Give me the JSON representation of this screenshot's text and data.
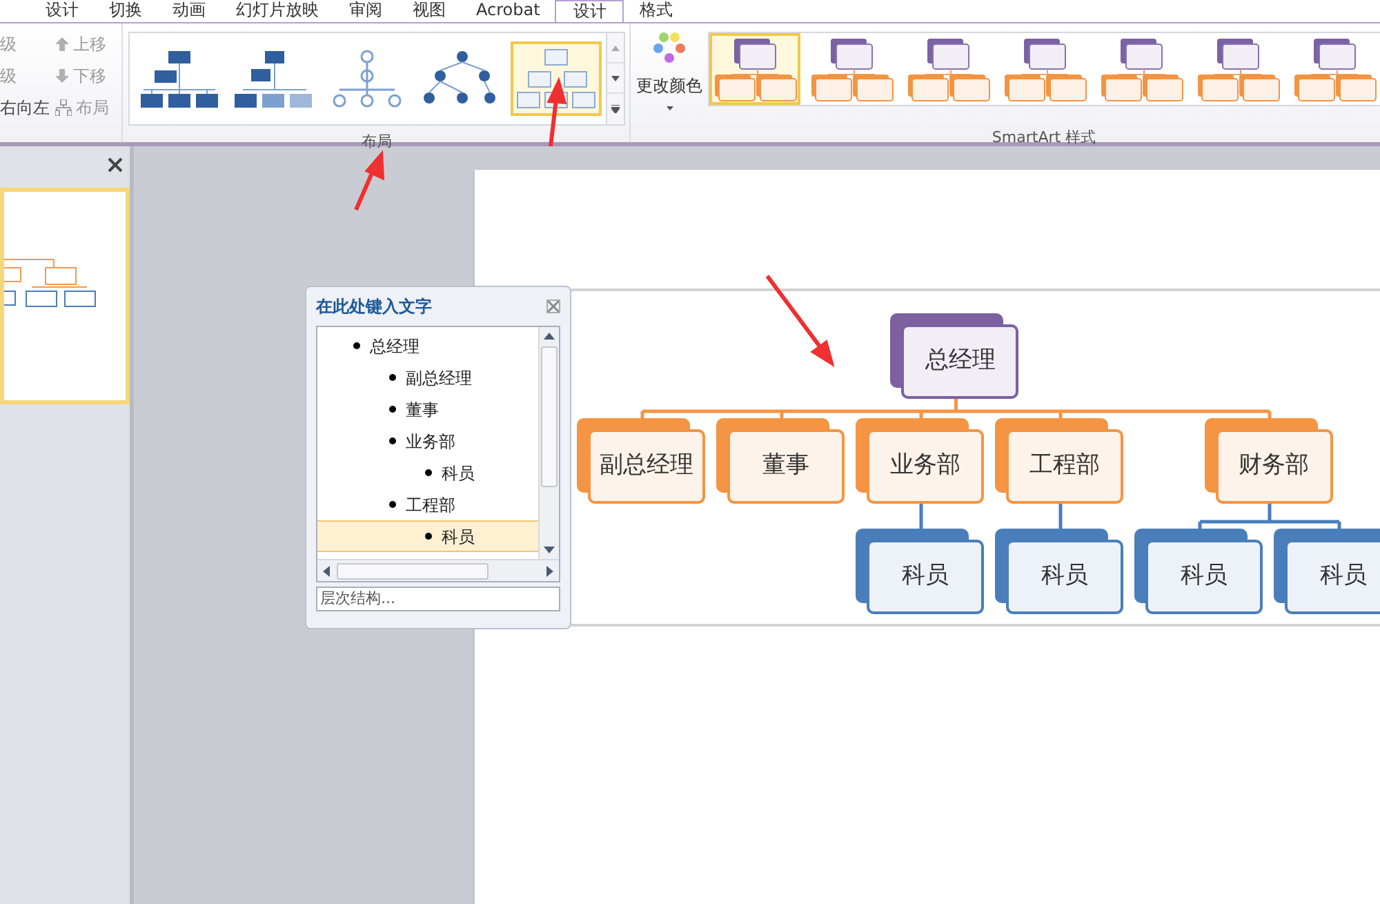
{
  "ribbon_tabs": [
    {
      "label": "设计",
      "selected": false
    },
    {
      "label": "切换",
      "selected": false
    },
    {
      "label": "动画",
      "selected": false
    },
    {
      "label": "幻灯片放映",
      "selected": false
    },
    {
      "label": "审阅",
      "selected": false
    },
    {
      "label": "视图",
      "selected": false
    },
    {
      "label": "Acrobat",
      "selected": false
    },
    {
      "label": "设计",
      "selected": true
    },
    {
      "label": "格式",
      "selected": false
    }
  ],
  "create_group": {
    "left_items": [
      {
        "label": "级",
        "disabled": true
      },
      {
        "label": "级",
        "disabled": true
      },
      {
        "label": "右向左",
        "disabled": false
      }
    ],
    "move_items": [
      {
        "kind": "up",
        "label": "上移",
        "disabled": true
      },
      {
        "kind": "down",
        "label": "下移",
        "disabled": true
      },
      {
        "kind": "layout",
        "label": "布局",
        "disabled": true
      }
    ]
  },
  "layouts": {
    "label": "布局",
    "items": [
      {
        "kind": "org",
        "selected": false
      },
      {
        "kind": "org-named",
        "selected": false
      },
      {
        "kind": "circle",
        "selected": false
      },
      {
        "kind": "labeled",
        "selected": false
      },
      {
        "kind": "hierarchy",
        "selected": true
      }
    ]
  },
  "change_color": {
    "label": "更改颜色"
  },
  "styles": {
    "label": "SmartArt 样式",
    "items": [
      {
        "selected": true
      },
      {
        "selected": false
      },
      {
        "selected": false
      },
      {
        "selected": false
      },
      {
        "selected": false
      },
      {
        "selected": false
      },
      {
        "selected": false
      }
    ]
  },
  "slides_panel": {
    "thumbnails": [
      {
        "selected": true
      }
    ]
  },
  "text_pane": {
    "title": "在此处键入文字",
    "footer": "层次结构...",
    "items": [
      {
        "text": "总经理",
        "selected": false,
        "children": [
          {
            "text": "副总经理",
            "selected": false
          },
          {
            "text": "董事",
            "selected": false
          },
          {
            "text": "业务部",
            "selected": false,
            "children": [
              {
                "text": "科员",
                "selected": false
              }
            ]
          },
          {
            "text": "工程部",
            "selected": false,
            "children": [
              {
                "text": "科员",
                "selected": true
              }
            ]
          }
        ]
      }
    ]
  },
  "org_chart": {
    "root": {
      "text": "总经理",
      "children": [
        {
          "text": "副总经理"
        },
        {
          "text": "董事"
        },
        {
          "text": "业务部",
          "children": [
            {
              "text": "科员"
            }
          ]
        },
        {
          "text": "工程部",
          "children": [
            {
              "text": "科员"
            }
          ]
        },
        {
          "text": "财务部",
          "children": [
            {
              "text": "科员"
            },
            {
              "text": "科员"
            }
          ]
        }
      ]
    }
  }
}
